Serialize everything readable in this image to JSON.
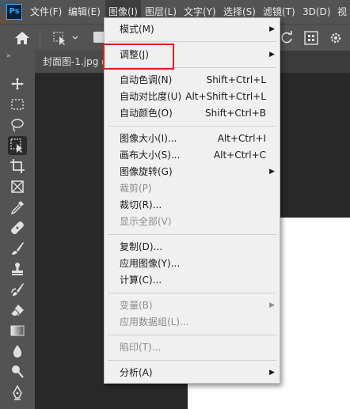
{
  "menubar": {
    "logo": "Ps",
    "items": [
      "文件(F)",
      "编辑(E)",
      "图像(I)",
      "图层(L)",
      "文字(Y)",
      "选择(S)",
      "滤镜(T)",
      "3D(D)",
      "视"
    ]
  },
  "tab": {
    "title": "封面图-1.jpg @"
  },
  "toolbar": {
    "collapse": "»"
  },
  "image_menu": {
    "items": {
      "mode": {
        "label": "模式(M)"
      },
      "adjust": {
        "label": "调整(J)"
      },
      "auto_tone": {
        "label": "自动色调(N)",
        "shortcut": "Shift+Ctrl+L"
      },
      "auto_contrast": {
        "label": "自动对比度(U)",
        "shortcut": "Alt+Shift+Ctrl+L"
      },
      "auto_color": {
        "label": "自动颜色(O)",
        "shortcut": "Shift+Ctrl+B"
      },
      "image_size": {
        "label": "图像大小(I)...",
        "shortcut": "Alt+Ctrl+I"
      },
      "canvas_size": {
        "label": "画布大小(S)...",
        "shortcut": "Alt+Ctrl+C"
      },
      "image_rotation": {
        "label": "图像旋转(G)"
      },
      "crop": {
        "label": "裁剪(P)"
      },
      "trim": {
        "label": "裁切(R)..."
      },
      "reveal_all": {
        "label": "显示全部(V)"
      },
      "duplicate": {
        "label": "复制(D)..."
      },
      "apply_image": {
        "label": "应用图像(Y)..."
      },
      "calculations": {
        "label": "计算(C)..."
      },
      "variables": {
        "label": "变量(B)"
      },
      "apply_data_set": {
        "label": "应用数据组(L)..."
      },
      "trap": {
        "label": "陷印(T)..."
      },
      "analysis": {
        "label": "分析(A)"
      }
    }
  },
  "colors": {
    "highlight": "#e02020",
    "menu_bg": "#f0f0f0",
    "app_bg": "#535353"
  }
}
